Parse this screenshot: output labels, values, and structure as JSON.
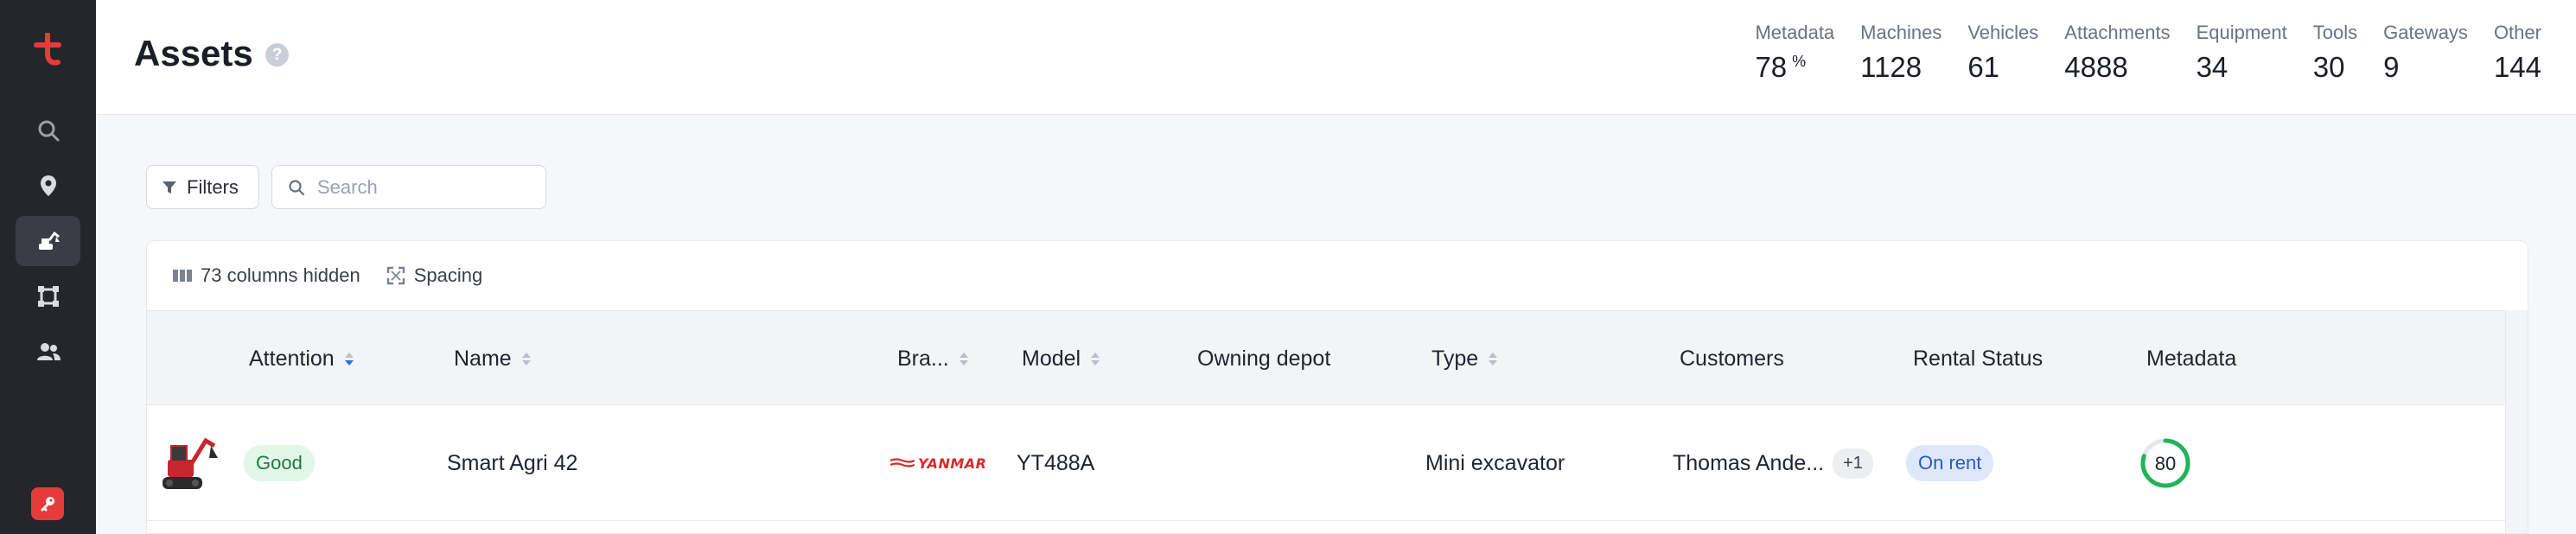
{
  "page": {
    "title": "Assets",
    "help_icon": "?"
  },
  "stats": [
    {
      "label": "Metadata",
      "value": "78",
      "unit": "%"
    },
    {
      "label": "Machines",
      "value": "1128"
    },
    {
      "label": "Vehicles",
      "value": "61"
    },
    {
      "label": "Attachments",
      "value": "4888"
    },
    {
      "label": "Equipment",
      "value": "34"
    },
    {
      "label": "Tools",
      "value": "30"
    },
    {
      "label": "Gateways",
      "value": "9"
    },
    {
      "label": "Other",
      "value": "144"
    }
  ],
  "toolbar": {
    "filters_label": "Filters",
    "search_placeholder": "Search",
    "search_value": ""
  },
  "table_tools": {
    "columns_hidden": "73 columns hidden",
    "spacing": "Spacing"
  },
  "columns": [
    "Attention",
    "Name",
    "Bra...",
    "Model",
    "Owning depot",
    "Type",
    "Customers",
    "Rental Status",
    "Metadata"
  ],
  "rows": [
    {
      "attention": "Good",
      "name": "Smart Agri 42",
      "brand": "YANMAR",
      "model": "YT488A",
      "owning_depot": "",
      "type": "Mini excavator",
      "customers": "Thomas Ande...",
      "customers_more": "+1",
      "rental_status": "On rent",
      "metadata": "80",
      "metadata_fraction": 0.8
    }
  ],
  "colors": {
    "accent": "#2f6be0",
    "good": "#22b357",
    "brand_red": "#d62b2b",
    "sidebar": "#24262c"
  }
}
